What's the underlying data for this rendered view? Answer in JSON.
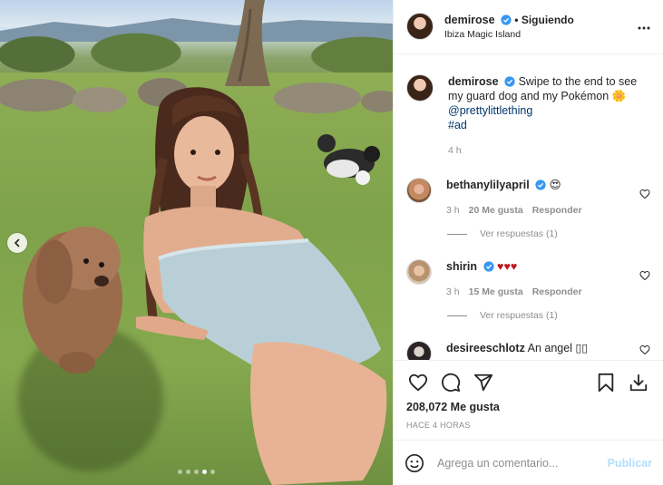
{
  "post": {
    "username": "demirose",
    "follow_separator": " • ",
    "follow_status": "Siguiendo",
    "location": "Ibiza Magic Island",
    "caption_text": "Swipe to the end to see my guard dog and my Pokémon",
    "caption_emoji": "🌼",
    "mention": "@prettylittlething",
    "hashtag": "#ad",
    "caption_time": "4 h",
    "likes": "208,072 Me gusta",
    "time_ago": "HACE 4 HORAS"
  },
  "comments": [
    {
      "username": "bethanylilyapril",
      "text": "😍",
      "time": "3 h",
      "likes": "20 Me gusta",
      "reply": "Responder",
      "view_replies": "Ver respuestas (1)"
    },
    {
      "username": "shirin",
      "text": "♥♥♥",
      "time": "3 h",
      "likes": "15 Me gusta",
      "reply": "Responder",
      "view_replies": "Ver respuestas (1)"
    },
    {
      "username": "desireeschlotz",
      "text": "An angel ▯▯"
    }
  ],
  "composer": {
    "placeholder": "Agrega un comentario...",
    "publish": "Publicar"
  },
  "carousel": {
    "slide_count": 5,
    "active_index": 3
  },
  "colors": {
    "verified": "#3897f0",
    "link": "#00376b",
    "publish_disabled": "#b2dffc",
    "heart_red": "#c0141e"
  }
}
